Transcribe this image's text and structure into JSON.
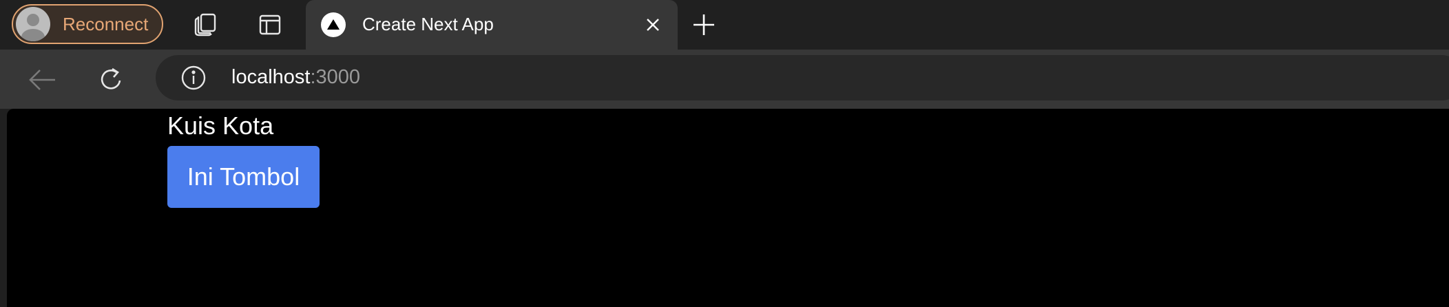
{
  "browser": {
    "profile": {
      "label": "Reconnect",
      "icon": "avatar-icon"
    },
    "tabbar_icons": [
      "workspaces-icon",
      "tab-actions-icon"
    ],
    "active_tab": {
      "title": "Create Next App",
      "favicon": "nextjs-triangle-icon",
      "close_icon": "close-icon"
    },
    "new_tab_icon": "plus-icon",
    "toolbar": {
      "back_icon": "back-arrow-icon",
      "refresh_icon": "refresh-icon"
    },
    "address": {
      "host": "localhost",
      "port": ":3000",
      "info_icon": "info-icon"
    }
  },
  "page": {
    "heading": "Kuis Kota",
    "button_label": "Ini Tombol",
    "button_color": "#4b7ded",
    "background": "#000000"
  },
  "colors": {
    "profile_accent": "#e1a371",
    "tabbar_bg": "#202020",
    "toolbar_bg": "#373737"
  }
}
